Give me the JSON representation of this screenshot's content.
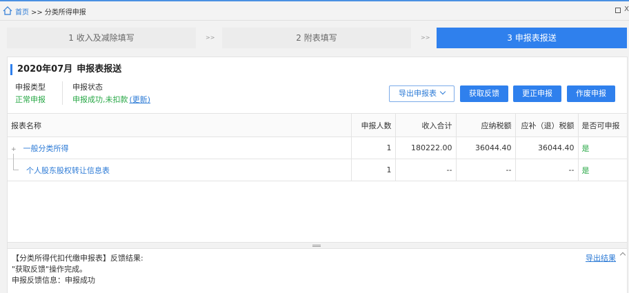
{
  "breadcrumb": {
    "home": "首页",
    "separator": ">>",
    "current": "分类所得申报"
  },
  "window_controls": {
    "restore_icon": "restore-icon",
    "close_label": "X"
  },
  "steps": [
    {
      "label": "1 收入及减除填写",
      "active": false
    },
    {
      "label": "2 附表填写",
      "active": false
    },
    {
      "label": "3 申报表报送",
      "active": true
    }
  ],
  "step_separator": ">>",
  "report": {
    "period": "2020年07月",
    "title": "申报表报送",
    "type_label": "申报类型",
    "type_value": "正常申报",
    "status_label": "申报状态",
    "status_value": "申报成功,未扣款",
    "refresh_link": "(更新)"
  },
  "actions": {
    "export_dropdown": "导出申报表",
    "get_feedback": "获取反馈",
    "correct": "更正申报",
    "void": "作废申报"
  },
  "table": {
    "headers": [
      "报表名称",
      "申报人数",
      "收入合计",
      "应纳税额",
      "应补（退）税额",
      "是否可申报"
    ],
    "rows": [
      {
        "name": "一般分类所得",
        "count": "1",
        "income": "180222.00",
        "tax": "36044.40",
        "payable": "36044.40",
        "can_report": "是"
      },
      {
        "name": "个人股东股权转让信息表",
        "count": "1",
        "income": "--",
        "tax": "--",
        "payable": "--",
        "can_report": "是"
      }
    ]
  },
  "feedback": {
    "line1": "【分类所得代扣代缴申报表】反馈结果:",
    "line2": "\"获取反馈\"操作完成。",
    "line3": "申报反馈信息：申报成功",
    "export_link": "导出结果"
  },
  "colors": {
    "accent": "#2f80ed",
    "success": "#27a745"
  }
}
